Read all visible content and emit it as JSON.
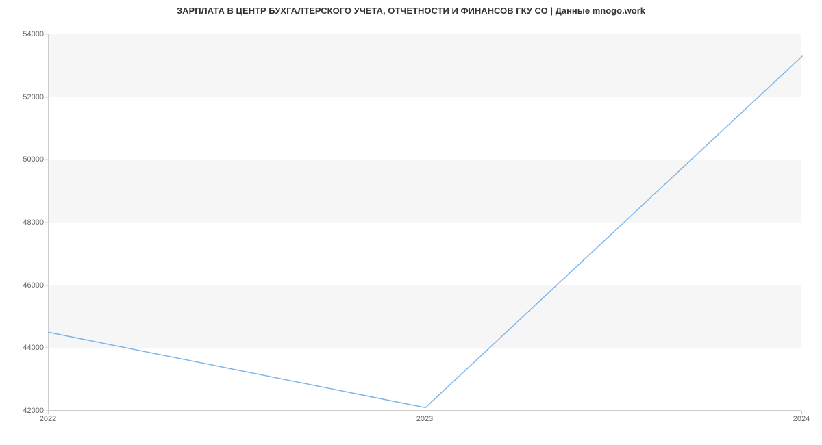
{
  "chart_data": {
    "type": "line",
    "title": "ЗАРПЛАТА В ЦЕНТР БУХГАЛТЕРСКОГО УЧЕТА, ОТЧЕТНОСТИ И ФИНАНСОВ ГКУ СО | Данные mnogo.work",
    "xlabel": "",
    "ylabel": "",
    "x": [
      2022,
      2023,
      2024
    ],
    "y": [
      44500,
      42100,
      53300
    ],
    "x_ticks": [
      2022,
      2023,
      2024
    ],
    "y_ticks": [
      42000,
      44000,
      46000,
      48000,
      50000,
      52000,
      54000
    ],
    "xlim": [
      2022,
      2024
    ],
    "ylim": [
      42000,
      54000
    ],
    "line_color": "#7cb5ec",
    "band_color": "#f6f6f6"
  }
}
